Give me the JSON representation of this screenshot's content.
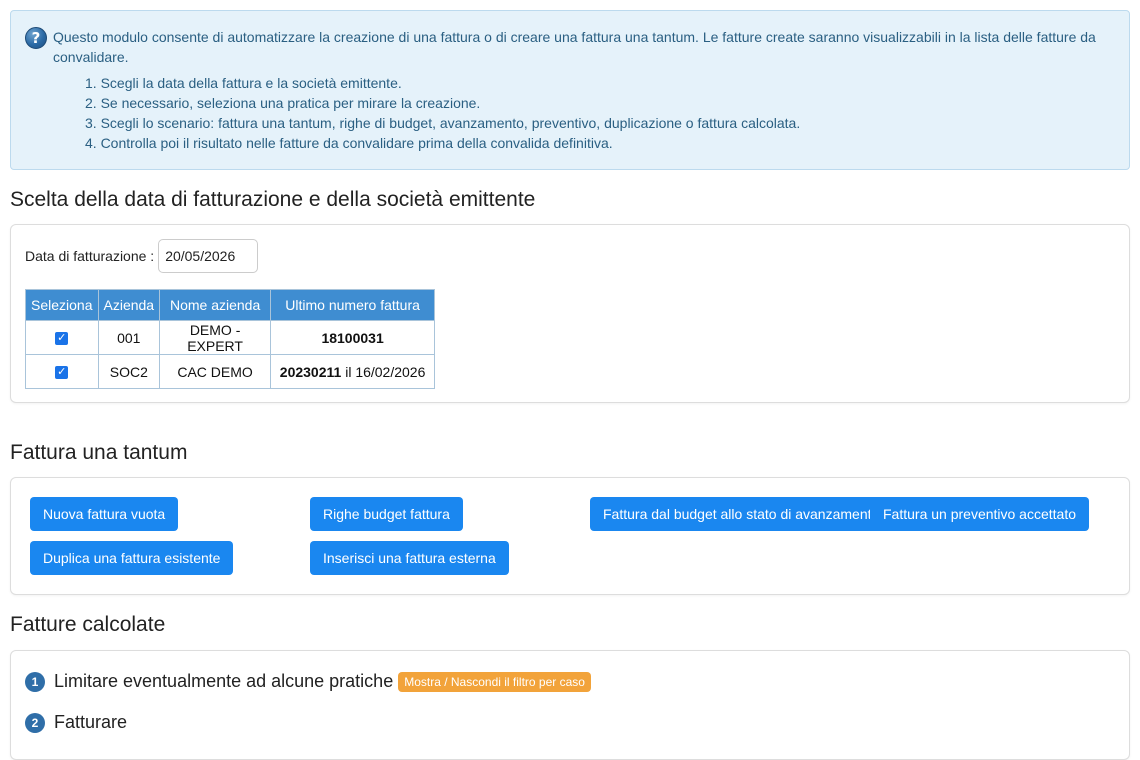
{
  "info": {
    "icon": "help-icon",
    "intro": "Questo modulo consente di automatizzare la creazione di una fattura o di creare una fattura una tantum. Le fatture create saranno visualizzabili in la lista delle fatture da convalidare.",
    "steps": [
      "1. Scegli la data della fattura e la società emittente.",
      "2. Se necessario, seleziona una pratica per mirare la creazione.",
      "3. Scegli lo scenario: fattura una tantum, righe di budget, avanzamento, preventivo, duplicazione o fattura calcolata.",
      "4. Controlla poi il risultato nelle fatture da convalidare prima della convalida definitiva."
    ]
  },
  "section1": {
    "title": "Scelta della data di fatturazione e della società emittente",
    "date_label": "Data di fatturazione :",
    "date_value": "20/05/2026",
    "columns": [
      "Seleziona",
      "Azienda",
      "Nome azienda",
      "Ultimo numero fattura"
    ],
    "rows": [
      {
        "checked": true,
        "code": "001",
        "name": "DEMO - EXPERT",
        "last_number": "18100031",
        "last_suffix": ""
      },
      {
        "checked": true,
        "code": "SOC2",
        "name": "CAC DEMO",
        "last_number": "20230211",
        "last_suffix": " il 16/02/2026"
      }
    ]
  },
  "section2": {
    "title": "Fattura una tantum",
    "buttons": {
      "new_empty": "Nuova fattura vuota",
      "budget_lines": "Righe budget fattura",
      "budget_progress": "Fattura dal budget allo stato di avanzamento",
      "accepted_quote": "Fattura un preventivo accettato",
      "duplicate": "Duplica una fattura esistente",
      "external": "Inserisci una fattura esterna"
    }
  },
  "section3": {
    "title": "Fatture calcolate",
    "step1_num": "1",
    "step1_label": "Limitare eventualmente ad alcune pratiche",
    "filter_badge": "Mostra / Nascondi il filtro per caso",
    "step2_num": "2",
    "step2_label": "Fatturare"
  },
  "colors": {
    "accent": "#1a87f0",
    "table_header": "#3f8dd1",
    "info_bg": "#e5f2fa",
    "badge": "#f2a33a"
  }
}
